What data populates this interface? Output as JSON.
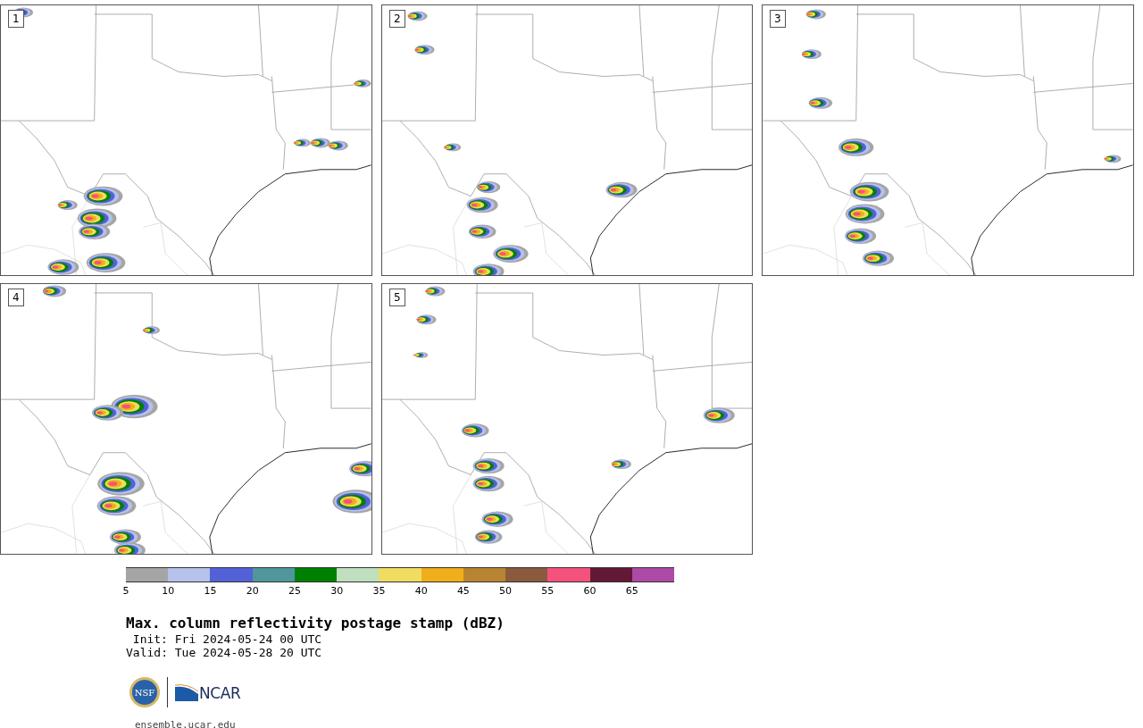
{
  "panels": [
    {
      "label": "1"
    },
    {
      "label": "2"
    },
    {
      "label": "3"
    },
    {
      "label": "4"
    },
    {
      "label": "5"
    }
  ],
  "colorbar": {
    "segments": [
      {
        "color": "#a5a5a5"
      },
      {
        "color": "#b6c1ec"
      },
      {
        "color": "#5262d6"
      },
      {
        "color": "#4f979b"
      },
      {
        "color": "#008000"
      },
      {
        "color": "#bfdfbf"
      },
      {
        "color": "#f0dc60"
      },
      {
        "color": "#f0ae1a"
      },
      {
        "color": "#b98432"
      },
      {
        "color": "#8b5a3e"
      },
      {
        "color": "#f4527d"
      },
      {
        "color": "#631835"
      },
      {
        "color": "#ac4aa6"
      }
    ],
    "labels": [
      "5",
      "10",
      "15",
      "20",
      "25",
      "30",
      "35",
      "40",
      "45",
      "50",
      "55",
      "60",
      "65"
    ]
  },
  "title": "Max. column reflectivity postage stamp (dBZ)",
  "init": "Init: Fri 2024-05-24 00 UTC",
  "valid": "Valid: Tue 2024-05-28 20 UTC",
  "logo": {
    "nsf": "NSF",
    "ncar": "NCAR"
  },
  "footer": "ensemble.ucar.edu"
}
